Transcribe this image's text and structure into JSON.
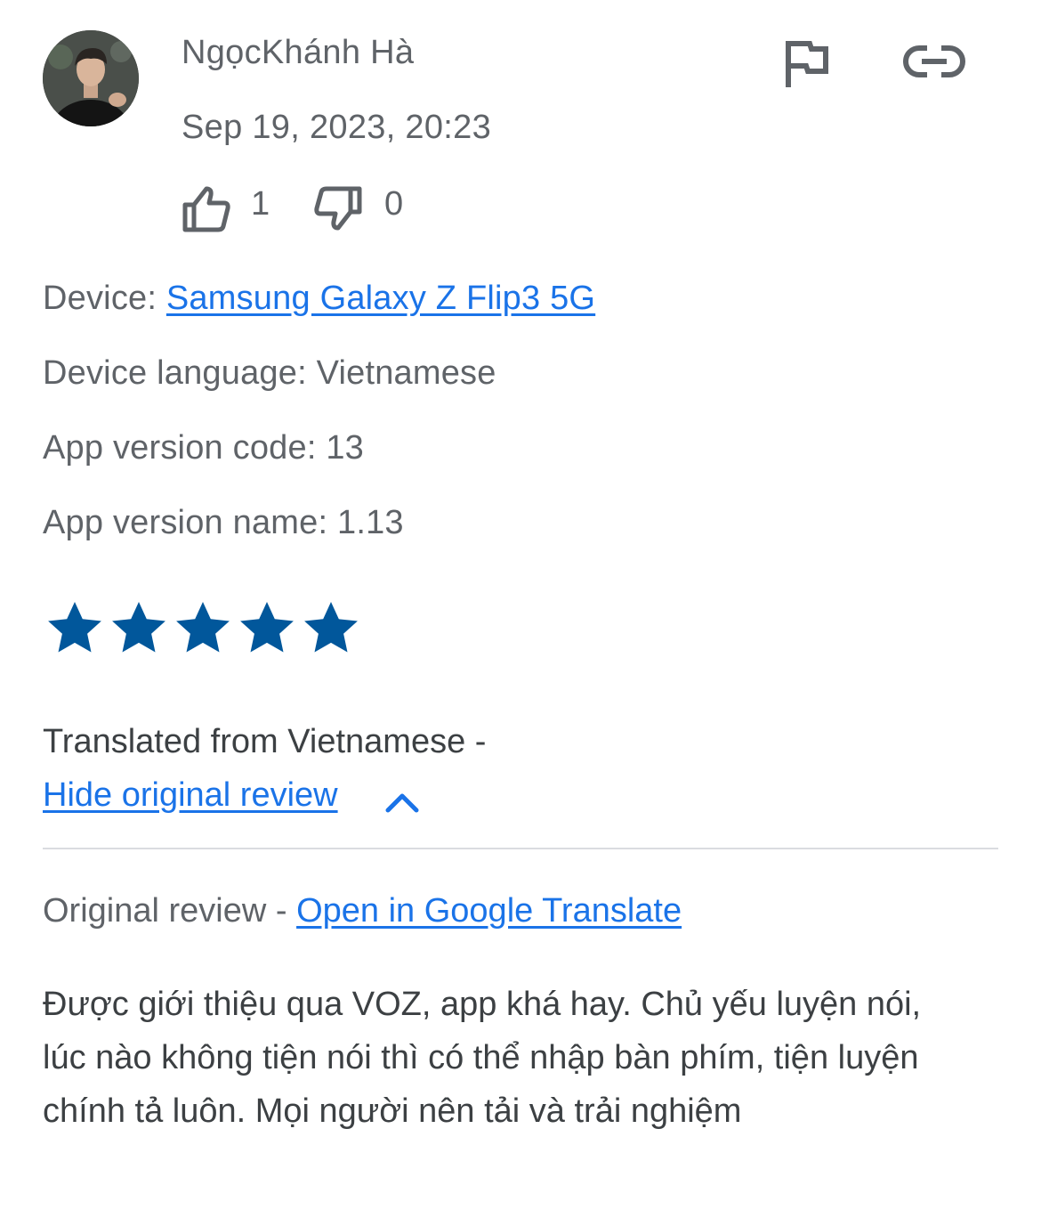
{
  "review": {
    "author": "NgọcKhánh Hà",
    "date": "Sep 19, 2023, 20:23",
    "thumbs_up_count": "1",
    "thumbs_down_count": "0",
    "device_label": "Device: ",
    "device_value": "Samsung Galaxy Z Flip3 5G",
    "device_language": "Device language: Vietnamese",
    "app_version_code": "App version code: 13",
    "app_version_name": "App version name: 1.13",
    "rating": 5,
    "translated_from": "Translated from Vietnamese -",
    "hide_original_label": "Hide original review",
    "original_label": "Original review - ",
    "open_translate_label": "Open in Google Translate",
    "original_text": "Được giới thiệu qua VOZ, app khá hay. Chủ yếu luyện nói, lúc nào không tiện nói thì có thể nhập bàn phím, tiện luyện chính tả luôn. Mọi người nên tải và trải nghiệm"
  },
  "icons": {
    "flag": "flag-icon",
    "link": "link-icon",
    "thumbs_up": "thumbs-up-icon",
    "thumbs_down": "thumbs-down-icon",
    "star": "star-icon",
    "chevron": "chevron-up-icon"
  },
  "colors": {
    "link": "#1a73e8",
    "star": "#01579b",
    "icon": "#5f6368",
    "text": "#3c4043",
    "divider": "#dadce0"
  }
}
